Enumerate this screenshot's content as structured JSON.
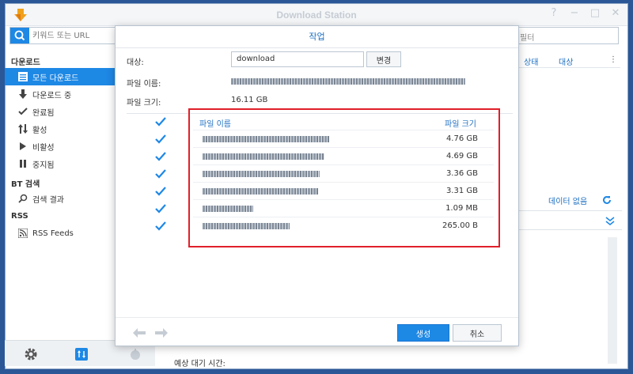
{
  "app": {
    "title": "Download Station"
  },
  "search": {
    "placeholder": "키워드 또는 URL"
  },
  "filter": {
    "placeholder": "필터"
  },
  "sidebar": {
    "download_head": "다운로드",
    "items": [
      {
        "label": "모든 다운로드",
        "icon": "list-icon"
      },
      {
        "label": "다운로드 중",
        "icon": "arrow-down-icon"
      },
      {
        "label": "완료됨",
        "icon": "check-icon"
      },
      {
        "label": "활성",
        "icon": "updown-arrows-icon"
      },
      {
        "label": "비활성",
        "icon": "pause-icon"
      },
      {
        "label": "중지됨",
        "icon": "stop-icon"
      }
    ],
    "bt_head": "BT 검색",
    "bt_items": [
      {
        "label": "검색 결과",
        "icon": "search-icon"
      }
    ],
    "rss_head": "RSS",
    "rss_items": [
      {
        "label": "RSS Feeds",
        "icon": "rss-icon"
      }
    ]
  },
  "list": {
    "col_status": "상태",
    "col_dest": "대상",
    "no_data": "데이터 없음",
    "eta_label": "예상 대기 시간:"
  },
  "dialog": {
    "title": "작업",
    "dest_label": "대상:",
    "dest_value": "download",
    "change_button": "변경",
    "filename_label": "파일 이름:",
    "filesize_label": "파일 크기:",
    "filesize_value": "16.11 GB",
    "table": {
      "col_name": "파일 이름",
      "col_size": "파일 크기",
      "rows": [
        {
          "size": "4.76 GB",
          "checked": true
        },
        {
          "size": "4.69 GB",
          "checked": true
        },
        {
          "size": "3.36 GB",
          "checked": true
        },
        {
          "size": "3.31 GB",
          "checked": true
        },
        {
          "size": "1.09 MB",
          "checked": true
        },
        {
          "size": "265.00 B",
          "checked": true
        }
      ]
    },
    "create_button": "생성",
    "cancel_button": "취소"
  },
  "colors": {
    "accent": "#1e88e5",
    "highlight": "#e01f2a"
  }
}
